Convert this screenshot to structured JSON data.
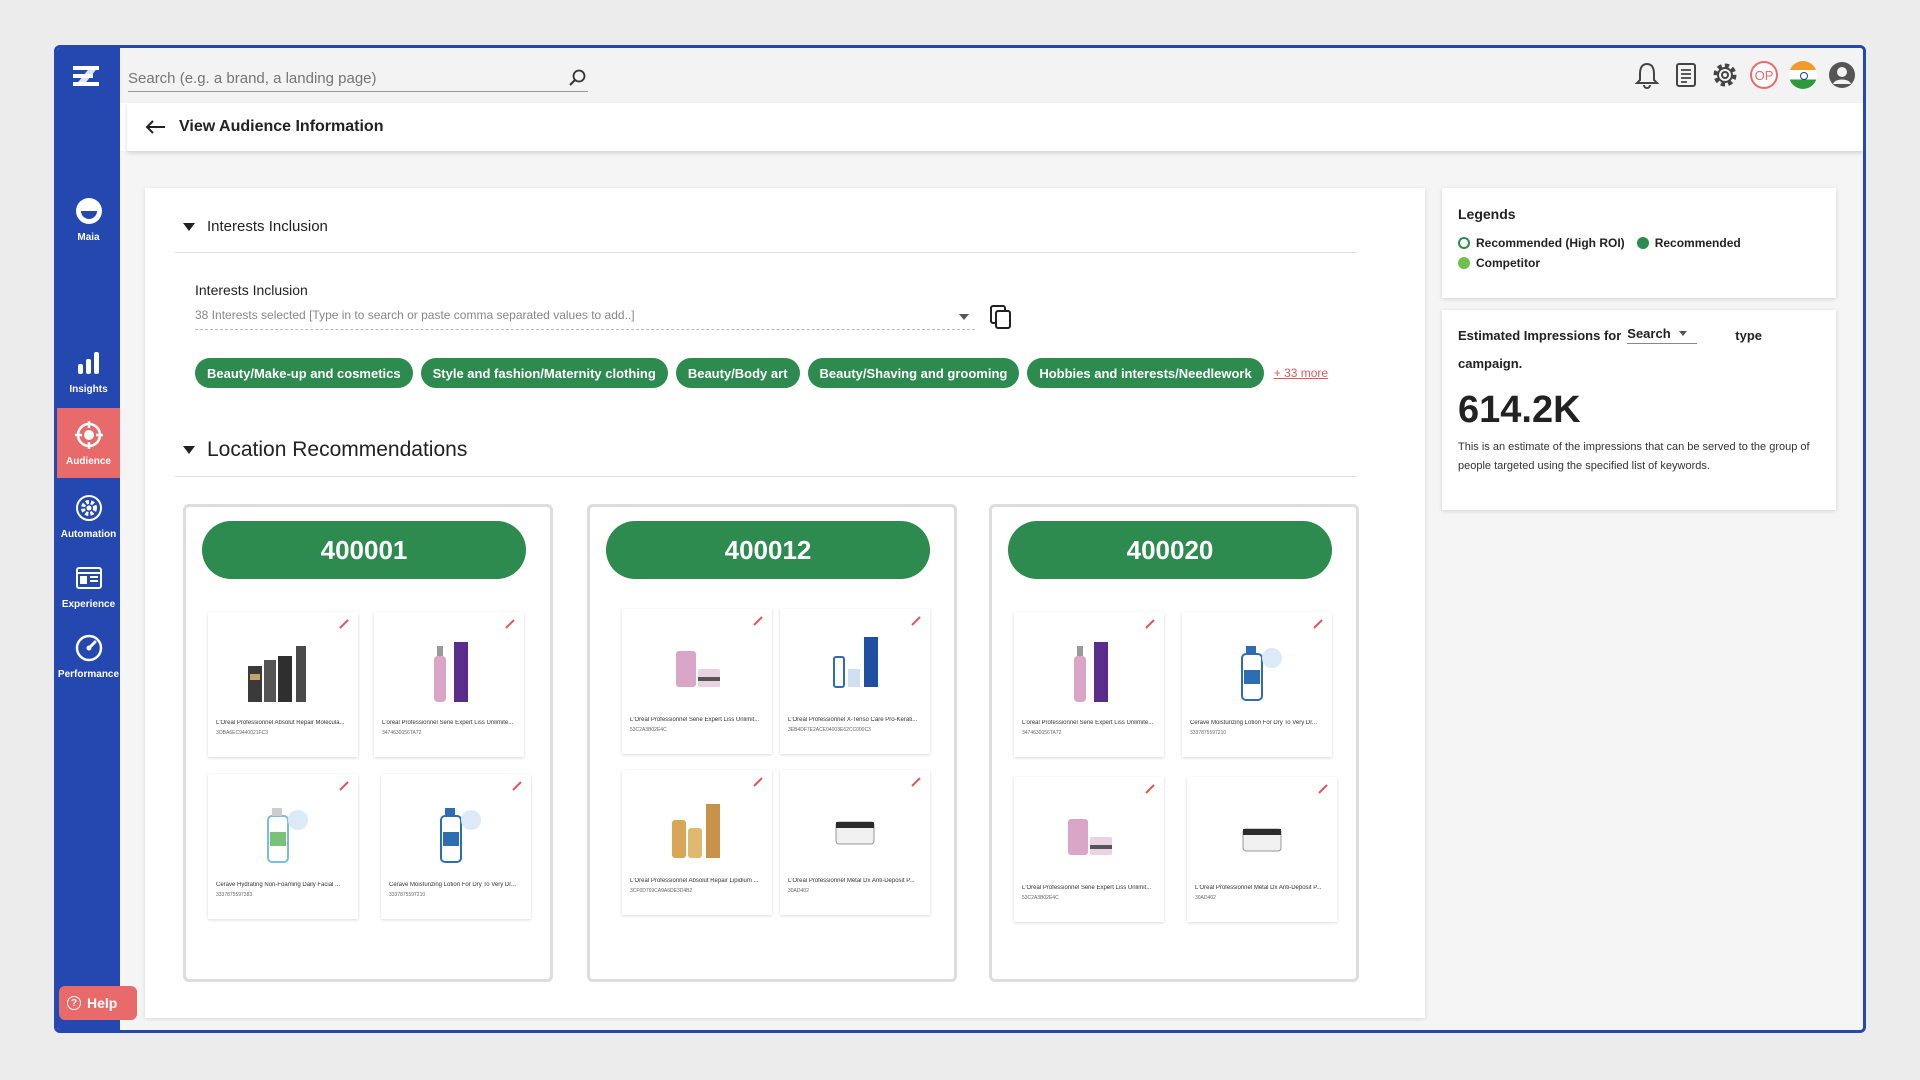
{
  "search": {
    "placeholder": "Search (e.g. a brand, a landing page)"
  },
  "sidebar": {
    "items": [
      {
        "label": "Maia",
        "icon": "maia-icon"
      },
      {
        "label": "Insights",
        "icon": "bar-chart-icon"
      },
      {
        "label": "Audience",
        "icon": "target-icon",
        "active": true
      },
      {
        "label": "Automation",
        "icon": "gear-icon"
      },
      {
        "label": "Experience",
        "icon": "layout-icon"
      },
      {
        "label": "Performance",
        "icon": "gauge-icon"
      }
    ],
    "help_label": "Help"
  },
  "topbar": {
    "user_initials": "OP"
  },
  "header": {
    "title": "View Audience Information"
  },
  "interests": {
    "section_title": "Interests Inclusion",
    "field_label": "Interests Inclusion",
    "field_placeholder": "38 Interests selected [Type in to search or paste comma separated values to add..]",
    "chips": [
      "Beauty/Make-up and cosmetics",
      "Style and fashion/Maternity clothing",
      "Beauty/Body art",
      "Beauty/Shaving and grooming",
      "Hobbies and interests/Needlework"
    ],
    "more_link": "+ 33 more"
  },
  "locations": {
    "section_title": "Location Recommendations",
    "cards": [
      {
        "pincode": "400001",
        "products": [
          {
            "name": "L'Oreal Professionnel Absolut Repair Molecula...",
            "id": "3OBA6EC9440021FC3"
          },
          {
            "name": "L'oreal Professionnel Serie Expert Liss Unlimite...",
            "id": "3474630056TA72"
          },
          {
            "name": "Cerave Hydrating Non-Foaming Daily Facial ...",
            "id": "3337875597383"
          },
          {
            "name": "Cerave Moisturizing Lotion For Dry To Very Dr...",
            "id": "3337875597210"
          }
        ]
      },
      {
        "pincode": "400012",
        "products": [
          {
            "name": "L'Oreal Professionnel Serie Expert Liss Unlimit...",
            "id": "53C2A3B02E4C"
          },
          {
            "name": "L'Oreal Professionnel X-Tenso Care Pro-Kerati...",
            "id": "3EB4DF7E2ACE04003E62CC000C3"
          },
          {
            "name": "L'Oreal Professionnel Absolut Repair Lipidium ...",
            "id": "3CF0D769CA9A6DE3D4B2"
          },
          {
            "name": "L'Oreal Professionnel Metal Dx Anti-Deposit P...",
            "id": "30AD402"
          }
        ]
      },
      {
        "pincode": "400020",
        "products": [
          {
            "name": "L'oreal Professionnel Serie Expert Liss Unlimite...",
            "id": "3474630056TA72"
          },
          {
            "name": "Cerave Moisturizing Lotion For Dry To Very Dr...",
            "id": "3337875597210"
          },
          {
            "name": "L'Oreal Professionnel Serie Expert Liss Unlimit...",
            "id": "53C2A3B02E4C"
          },
          {
            "name": "L'Oreal Professionnel Metal Dx Anti-Deposit P...",
            "id": "30AD402"
          }
        ]
      }
    ]
  },
  "legends": {
    "title": "Legends",
    "items": [
      {
        "label": "Recommended (High ROI)",
        "color": "#2e8b4f",
        "style": "outline"
      },
      {
        "label": "Recommended",
        "color": "#2e8b4f",
        "style": "filled"
      },
      {
        "label": "Competitor",
        "color": "#6fbf4a",
        "style": "filled"
      }
    ]
  },
  "estimate": {
    "prefix": "Estimated Impressions for",
    "campaign_type": "Search",
    "suffix": "type",
    "line2": "campaign.",
    "value": "614.2K",
    "description": "This is an estimate of the impressions that can be served to the group of people targeted using the specified list of keywords."
  },
  "colors": {
    "brand": "#2447b0",
    "accent": "#e86a6a",
    "green": "#2e8b4f"
  }
}
